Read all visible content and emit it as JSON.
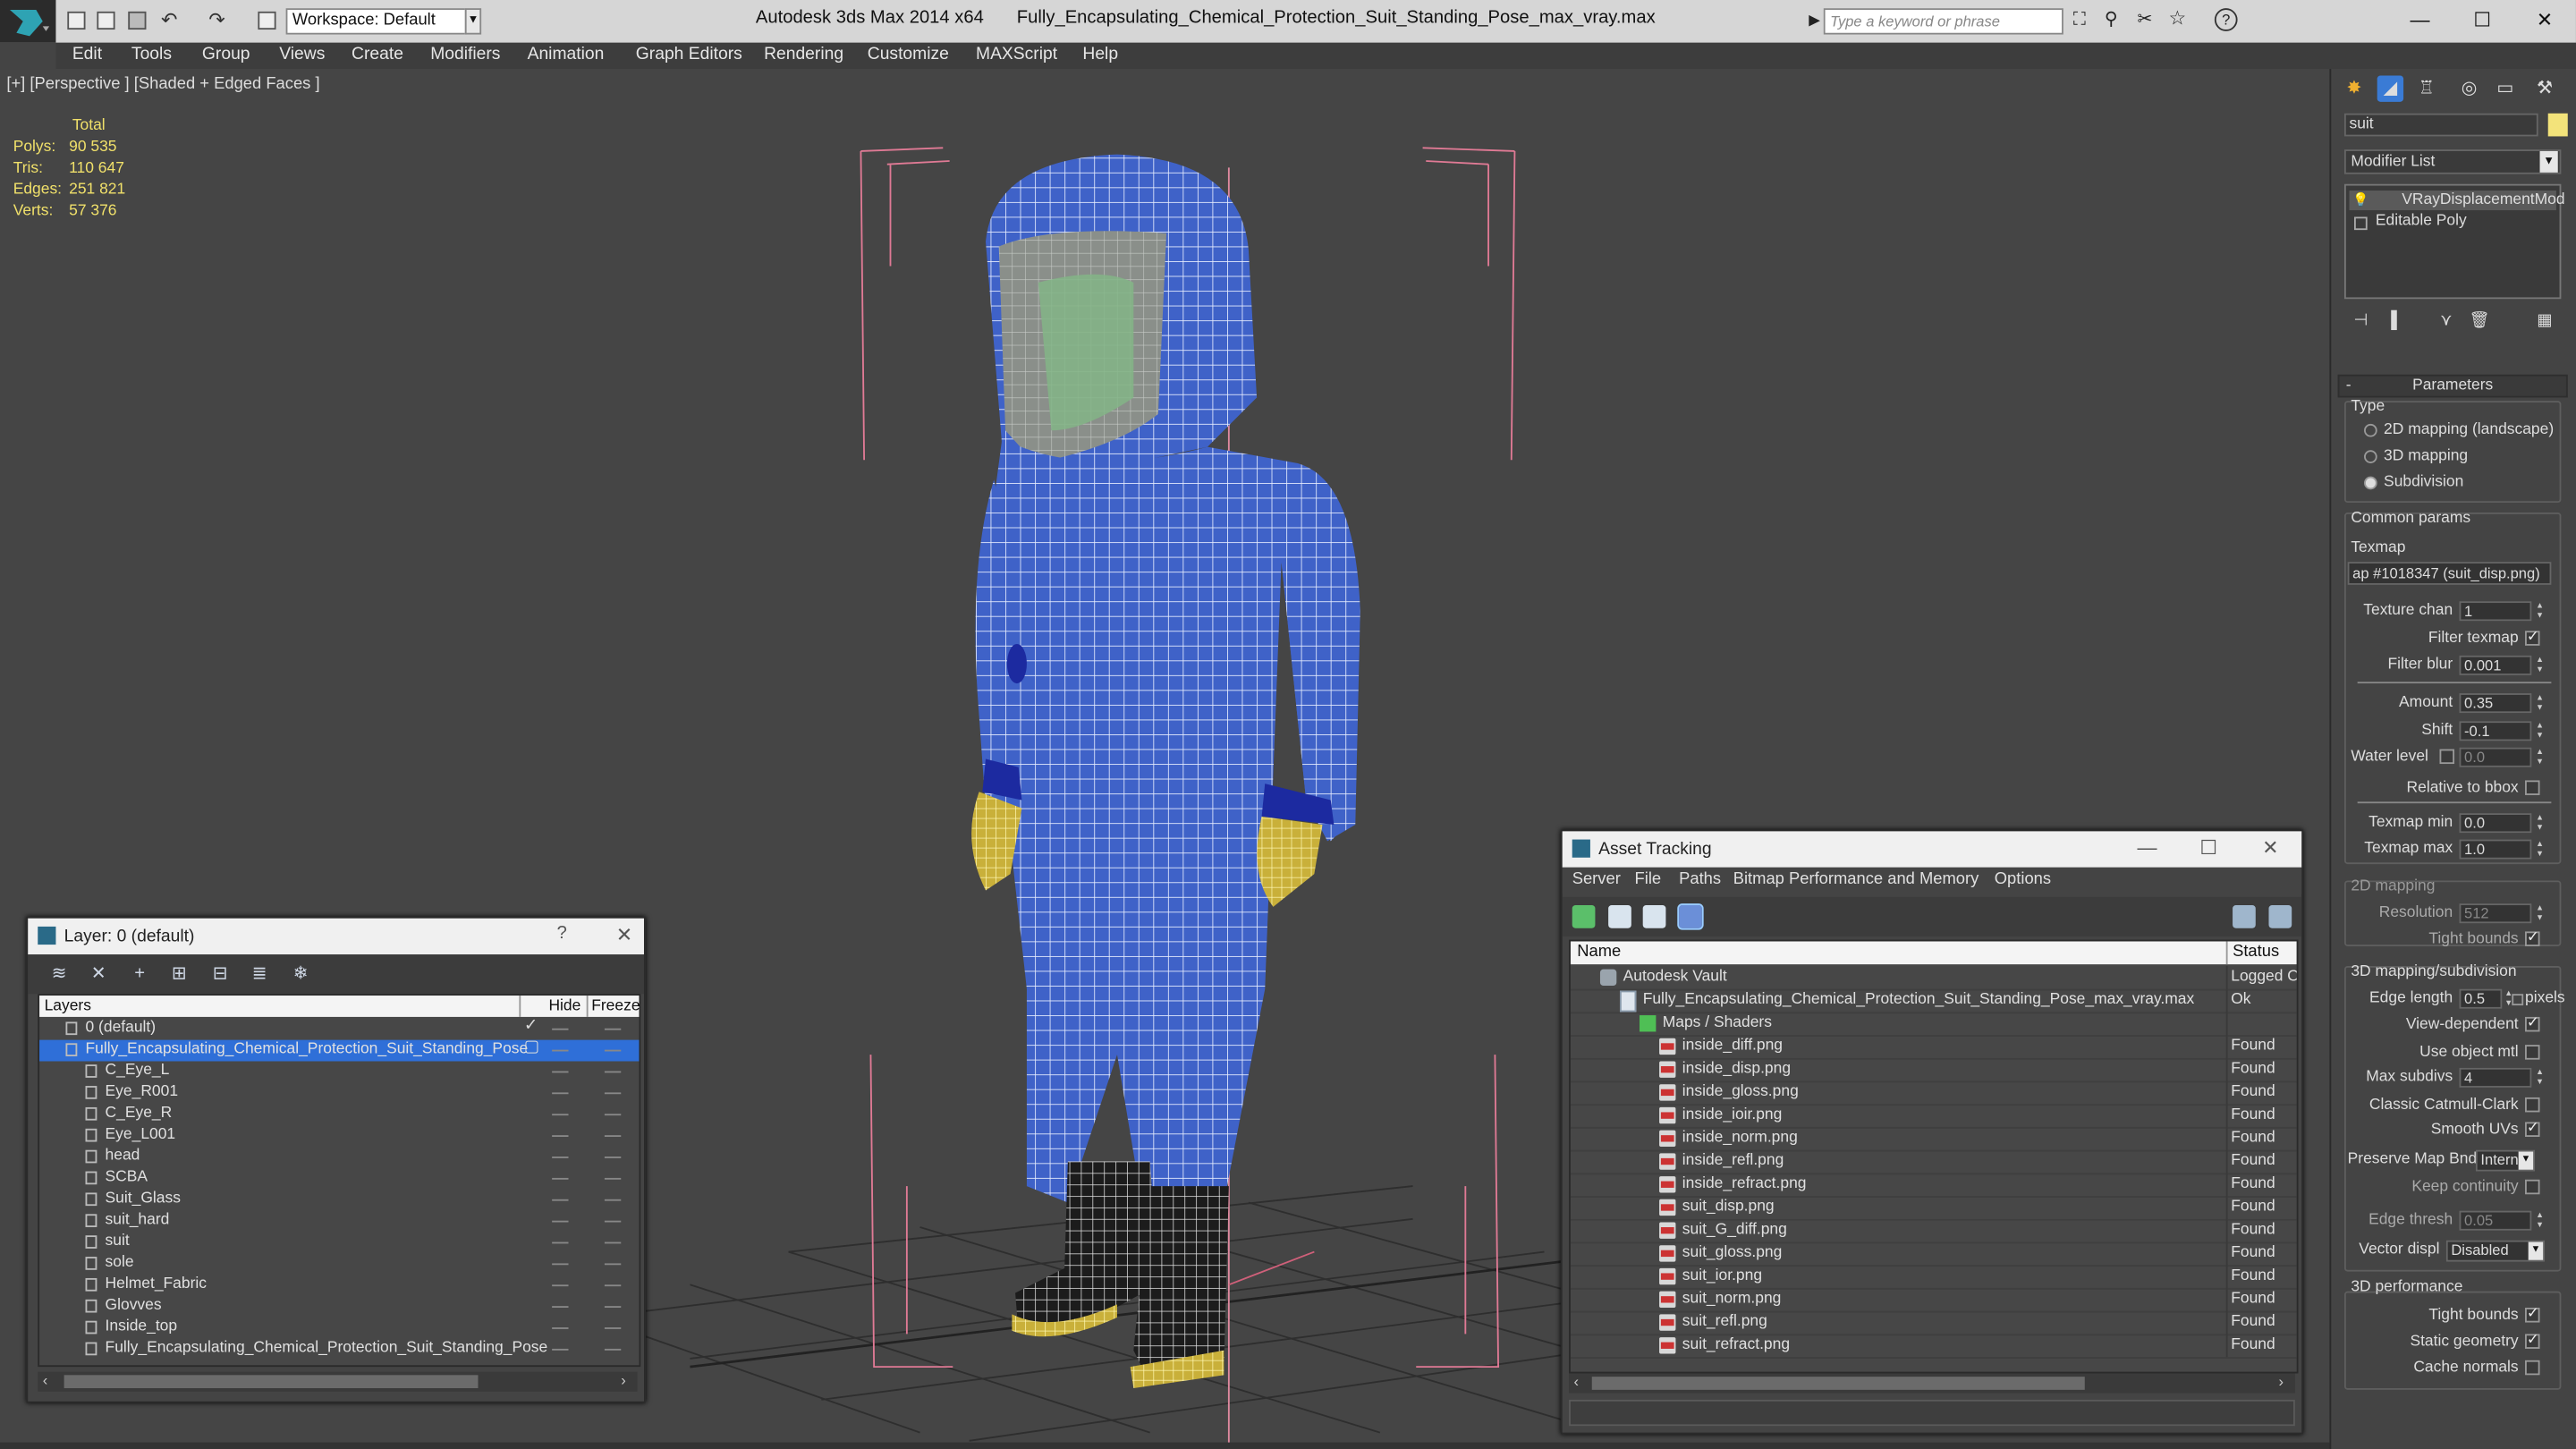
{
  "app": {
    "title": "Autodesk 3ds Max  2014 x64",
    "file": "Fully_Encapsulating_Chemical_Protection_Suit_Standing_Pose_max_vray.max",
    "workspace": "Workspace: Default",
    "search_placeholder": "Type a keyword or phrase"
  },
  "menu": [
    "Edit",
    "Tools",
    "Group",
    "Views",
    "Create",
    "Modifiers",
    "Animation",
    "Graph Editors",
    "Rendering",
    "Customize",
    "MAXScript",
    "Help"
  ],
  "viewport": {
    "label": "[+] [Perspective ] [Shaded + Edged Faces ]",
    "stats": {
      "header": "Total",
      "rows": [
        {
          "label": "Polys:",
          "value": "90 535"
        },
        {
          "label": "Tris:",
          "value": "110 647"
        },
        {
          "label": "Edges:",
          "value": "251 821"
        },
        {
          "label": "Verts:",
          "value": "57 376"
        }
      ]
    }
  },
  "layer_dialog": {
    "title": "Layer: 0 (default)",
    "help": "?",
    "close": "✕",
    "columns": {
      "name": "Layers",
      "hide": "Hide",
      "freeze": "Freeze"
    },
    "rows": [
      {
        "name": "0 (default)",
        "level": 0,
        "checked": true
      },
      {
        "name": "Fully_Encapsulating_Chemical_Protection_Suit_Standing_Pose",
        "level": 0,
        "selected": true
      },
      {
        "name": "C_Eye_L",
        "level": 1
      },
      {
        "name": "Eye_R001",
        "level": 1
      },
      {
        "name": "C_Eye_R",
        "level": 1
      },
      {
        "name": "Eye_L001",
        "level": 1
      },
      {
        "name": "head",
        "level": 1
      },
      {
        "name": "SCBA",
        "level": 1
      },
      {
        "name": "Suit_Glass",
        "level": 1
      },
      {
        "name": "suit_hard",
        "level": 1
      },
      {
        "name": "suit",
        "level": 1
      },
      {
        "name": "sole",
        "level": 1
      },
      {
        "name": "Helmet_Fabric",
        "level": 1
      },
      {
        "name": "Glovves",
        "level": 1
      },
      {
        "name": "Inside_top",
        "level": 1
      },
      {
        "name": "Fully_Encapsulating_Chemical_Protection_Suit_Standing_Pose",
        "level": 1
      }
    ]
  },
  "asset_tracking": {
    "title": "Asset Tracking",
    "menu": [
      "Server",
      "File",
      "Paths",
      "Bitmap Performance and Memory",
      "Options"
    ],
    "columns": {
      "name": "Name",
      "status": "Status"
    },
    "rows": [
      {
        "name": "Autodesk Vault",
        "status": "Logged O",
        "level": 0,
        "type": "vault"
      },
      {
        "name": "Fully_Encapsulating_Chemical_Protection_Suit_Standing_Pose_max_vray.max",
        "status": "Ok",
        "level": 1,
        "type": "max"
      },
      {
        "name": "Maps / Shaders",
        "status": "",
        "level": 2,
        "type": "folder"
      },
      {
        "name": "inside_diff.png",
        "status": "Found",
        "level": 3,
        "type": "file"
      },
      {
        "name": "inside_disp.png",
        "status": "Found",
        "level": 3,
        "type": "file"
      },
      {
        "name": "inside_gloss.png",
        "status": "Found",
        "level": 3,
        "type": "file"
      },
      {
        "name": "inside_ioir.png",
        "status": "Found",
        "level": 3,
        "type": "file"
      },
      {
        "name": "inside_norm.png",
        "status": "Found",
        "level": 3,
        "type": "file"
      },
      {
        "name": "inside_refl.png",
        "status": "Found",
        "level": 3,
        "type": "file"
      },
      {
        "name": "inside_refract.png",
        "status": "Found",
        "level": 3,
        "type": "file"
      },
      {
        "name": "suit_disp.png",
        "status": "Found",
        "level": 3,
        "type": "file"
      },
      {
        "name": "suit_G_diff.png",
        "status": "Found",
        "level": 3,
        "type": "file"
      },
      {
        "name": "suit_gloss.png",
        "status": "Found",
        "level": 3,
        "type": "file"
      },
      {
        "name": "suit_ior.png",
        "status": "Found",
        "level": 3,
        "type": "file"
      },
      {
        "name": "suit_norm.png",
        "status": "Found",
        "level": 3,
        "type": "file"
      },
      {
        "name": "suit_refl.png",
        "status": "Found",
        "level": 3,
        "type": "file"
      },
      {
        "name": "suit_refract.png",
        "status": "Found",
        "level": 3,
        "type": "file"
      }
    ]
  },
  "command_panel": {
    "object_name": "suit",
    "object_color": "#f3e37a",
    "modifier_list": "Modifier List",
    "stack": [
      "VRayDisplacementMod",
      "Editable Poly"
    ],
    "rollout": "Parameters",
    "type_label": "Type",
    "type_options": [
      {
        "label": "2D mapping (landscape)",
        "on": false
      },
      {
        "label": "3D mapping",
        "on": false
      },
      {
        "label": "Subdivision",
        "on": true
      }
    ],
    "common_params": "Common params",
    "texmap_label": "Texmap",
    "texmap_value": "ap #1018347 (suit_disp.png)",
    "texture_chan": {
      "label": "Texture chan",
      "value": "1"
    },
    "filter_texmap": {
      "label": "Filter texmap",
      "on": true
    },
    "filter_blur": {
      "label": "Filter blur",
      "value": "0.001"
    },
    "amount": {
      "label": "Amount",
      "value": "0.35"
    },
    "shift": {
      "label": "Shift",
      "value": "-0.1"
    },
    "water_level": {
      "label": "Water level",
      "value": "0.0"
    },
    "relative_bbox": {
      "label": "Relative to bbox",
      "on": false
    },
    "texmap_min": {
      "label": "Texmap min",
      "value": "0.0"
    },
    "texmap_max": {
      "label": "Texmap max",
      "value": "1.0"
    },
    "mapping2d": "2D mapping",
    "resolution": {
      "label": "Resolution",
      "value": "512"
    },
    "tight_bounds_2d": {
      "label": "Tight bounds",
      "on": true
    },
    "mapping3d": "3D mapping/subdivision",
    "edge_length": {
      "label": "Edge length",
      "value": "0.5",
      "unit": "pixels"
    },
    "view_dependent": {
      "label": "View-dependent",
      "on": true
    },
    "use_object_mtl": {
      "label": "Use object mtl",
      "on": false
    },
    "max_subdivs": {
      "label": "Max subdivs",
      "value": "4"
    },
    "classic_catmull": {
      "label": "Classic Catmull-Clark",
      "on": false
    },
    "smooth_uvs": {
      "label": "Smooth UVs",
      "on": true
    },
    "preserve_map": {
      "label": "Preserve Map Bnd",
      "value": "Intern"
    },
    "keep_continuity": {
      "label": "Keep continuity",
      "on": false
    },
    "edge_thresh": {
      "label": "Edge thresh",
      "value": "0.05"
    },
    "vector_displ": {
      "label": "Vector displ",
      "value": "Disabled"
    },
    "performance": "3D performance",
    "tight_bounds": {
      "label": "Tight bounds",
      "on": true
    },
    "static_geometry": {
      "label": "Static geometry",
      "on": true
    },
    "cache_normals": {
      "label": "Cache normals",
      "on": false
    }
  }
}
